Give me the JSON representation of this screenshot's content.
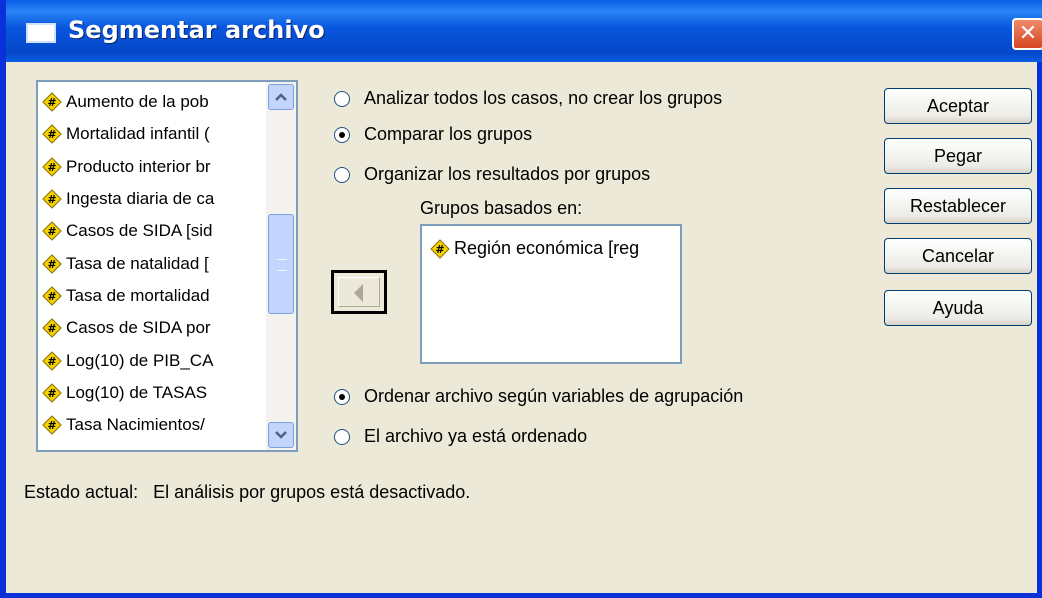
{
  "window": {
    "title": "Segmentar archivo",
    "close_glyph": "✕"
  },
  "variables": [
    "Aumento de la pob",
    "Mortalidad infantil (",
    "Producto interior br",
    "Ingesta diaria de ca",
    "Casos de SIDA [sid",
    "Tasa de natalidad [",
    "Tasa de mortalidad",
    "Casos de SIDA por",
    "Log(10) de PIB_CA",
    "Log(10) de TASAS",
    "Tasa Nacimientos/"
  ],
  "options": {
    "analyze_all": "Analizar todos los casos, no crear los grupos",
    "compare_groups": "Comparar los grupos",
    "organize_output": "Organizar los resultados por grupos",
    "selected_mode": "compare_groups"
  },
  "groups": {
    "label": "Grupos basados en:",
    "items": [
      "Región económica [reg"
    ]
  },
  "sort": {
    "sort_file": "Ordenar archivo según variables de agrupación",
    "already_sorted": "El archivo ya está ordenado",
    "selected": "sort_file"
  },
  "buttons": {
    "ok": "Aceptar",
    "paste": "Pegar",
    "reset": "Restablecer",
    "cancel": "Cancelar",
    "help": "Ayuda"
  },
  "status": {
    "label": "Estado actual:",
    "text": "El análisis por grupos está desactivado."
  },
  "icons": {
    "variable": "scale-variable-icon",
    "scroll_up": "chevron-up-icon",
    "scroll_down": "chevron-down-icon",
    "move": "arrow-left-icon"
  }
}
